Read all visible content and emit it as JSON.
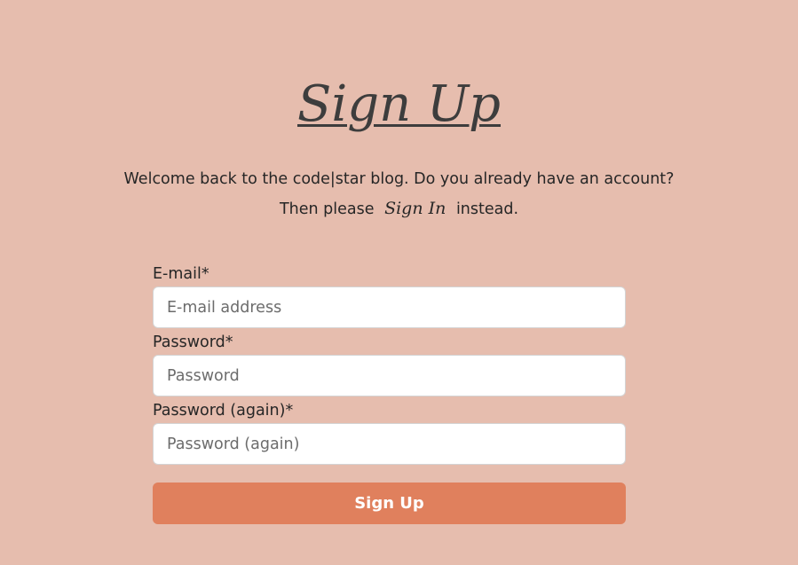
{
  "header": {
    "title": "Sign Up"
  },
  "intro": {
    "line1": "Welcome back to the code|star blog. Do you already have an account?",
    "line2_prefix": "Then please",
    "signin_link": "Sign In",
    "line2_suffix": "instead."
  },
  "form": {
    "email": {
      "label": "E-mail*",
      "placeholder": "E-mail address",
      "value": ""
    },
    "password": {
      "label": "Password*",
      "placeholder": "Password",
      "value": ""
    },
    "password_again": {
      "label": "Password (again)*",
      "placeholder": "Password (again)",
      "value": ""
    },
    "submit_label": "Sign Up"
  },
  "colors": {
    "background": "#e6bdae",
    "button": "#e0805d",
    "text": "#262626"
  }
}
